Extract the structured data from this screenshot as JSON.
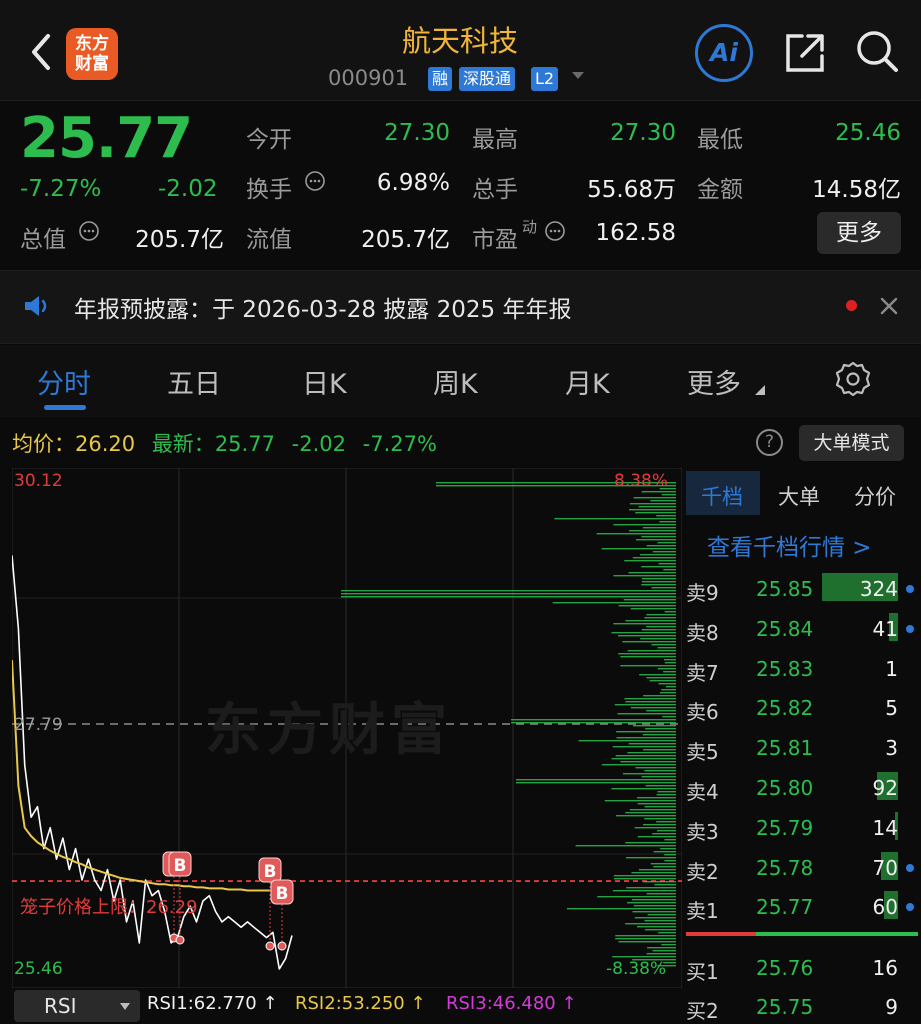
{
  "header": {
    "logo_line1": "东方",
    "logo_line2": "财富",
    "title": "航天科技",
    "code": "000901",
    "tags": [
      "融",
      "深股通",
      "L2"
    ],
    "ai_label": "Ai"
  },
  "quote": {
    "price": "25.77",
    "change_pct": "-7.27%",
    "change": "-2.02",
    "fields": {
      "open_label": "今开",
      "open": "27.30",
      "high_label": "最高",
      "high": "27.30",
      "low_label": "最低",
      "low": "25.46",
      "turnover_label": "换手",
      "turnover": "6.98%",
      "volume_label": "总手",
      "volume": "55.68万",
      "amount_label": "金额",
      "amount": "14.58亿",
      "mcap_label": "总值",
      "mcap": "205.7亿",
      "float_label": "流值",
      "float": "205.7亿",
      "pe_label": "市盈",
      "pe_sup": "动",
      "pe": "162.58"
    },
    "more_label": "更多"
  },
  "notice": {
    "text": "年报预披露：于 2026-03-28 披露 2025 年年报"
  },
  "tabs": [
    "分时",
    "五日",
    "日K",
    "周K",
    "月K",
    "更多"
  ],
  "active_tab": 0,
  "infobar": {
    "avg_label": "均价：",
    "avg": "26.20",
    "latest_label": "最新：",
    "latest": "25.77",
    "change": "-2.02",
    "change_pct": "-7.27%",
    "help": "?",
    "mode_label": "大单模式"
  },
  "chart_data": {
    "type": "line",
    "y_top": "30.12",
    "y_mid": "27.79",
    "y_bottom": "25.46",
    "pct_top": "8.38%",
    "pct_bottom": "-8.38%",
    "ylim": [
      25.46,
      30.12
    ],
    "watermark": "东方财富",
    "limit_label": "笼子价格上限：26.29",
    "limit_value": 26.29,
    "markers": [
      "B",
      "B",
      "B",
      "B"
    ],
    "series": [
      {
        "name": "price",
        "color": "#ffffff",
        "values": [
          29.4,
          28.7,
          27.4,
          26.9,
          27.0,
          26.6,
          26.8,
          26.5,
          26.7,
          26.4,
          26.6,
          26.3,
          26.5,
          26.3,
          26.2,
          26.4,
          26.1,
          26.3,
          25.9,
          26.1,
          25.7,
          26.3,
          26.15,
          26.2,
          26.0,
          25.7,
          25.75,
          25.95,
          26.05,
          25.9,
          26.1,
          26.15,
          26.0,
          25.9,
          25.95,
          25.9,
          25.85,
          25.9,
          25.85,
          25.8,
          25.75,
          25.8,
          25.45,
          25.55,
          25.77
        ]
      },
      {
        "name": "avg",
        "color": "#e8c84a",
        "values": [
          28.4,
          27.2,
          26.8,
          26.72,
          26.66,
          26.62,
          26.58,
          26.55,
          26.52,
          26.5,
          26.47,
          26.45,
          26.42,
          26.4,
          26.38,
          26.36,
          26.34,
          26.32,
          26.31,
          26.3,
          26.29,
          26.28,
          26.27,
          26.26,
          26.26,
          26.25,
          26.25,
          26.24,
          26.24,
          26.23,
          26.23,
          26.22,
          26.22,
          26.22,
          26.21,
          26.21,
          26.21,
          26.2,
          26.2,
          26.2,
          26.2,
          26.2,
          26.2,
          26.2,
          26.2
        ]
      }
    ]
  },
  "depth": {
    "tabs": [
      "千档",
      "大单",
      "分价"
    ],
    "link": "查看千档行情 >",
    "asks": [
      {
        "label": "卖9",
        "price": "25.85",
        "vol": "324",
        "bar": 1.0,
        "dot": true
      },
      {
        "label": "卖8",
        "price": "25.84",
        "vol": "41",
        "bar": 0.12,
        "dot": true
      },
      {
        "label": "卖7",
        "price": "25.83",
        "vol": "1",
        "bar": 0,
        "dot": false
      },
      {
        "label": "卖6",
        "price": "25.82",
        "vol": "5",
        "bar": 0,
        "dot": false
      },
      {
        "label": "卖5",
        "price": "25.81",
        "vol": "3",
        "bar": 0,
        "dot": false
      },
      {
        "label": "卖4",
        "price": "25.80",
        "vol": "92",
        "bar": 0.28,
        "dot": false
      },
      {
        "label": "卖3",
        "price": "25.79",
        "vol": "14",
        "bar": 0.04,
        "dot": false
      },
      {
        "label": "卖2",
        "price": "25.78",
        "vol": "70",
        "bar": 0.22,
        "dot": true
      },
      {
        "label": "卖1",
        "price": "25.77",
        "vol": "60",
        "bar": 0.18,
        "dot": true
      }
    ],
    "bids": [
      {
        "label": "买1",
        "price": "25.76",
        "vol": "16"
      },
      {
        "label": "买2",
        "price": "25.75",
        "vol": "9"
      }
    ]
  },
  "rsi": {
    "selector": "RSI",
    "rsi1": "RSI1:62.770 ↑",
    "rsi2": "RSI2:53.250 ↑",
    "rsi3": "RSI3:46.480 ↑"
  }
}
